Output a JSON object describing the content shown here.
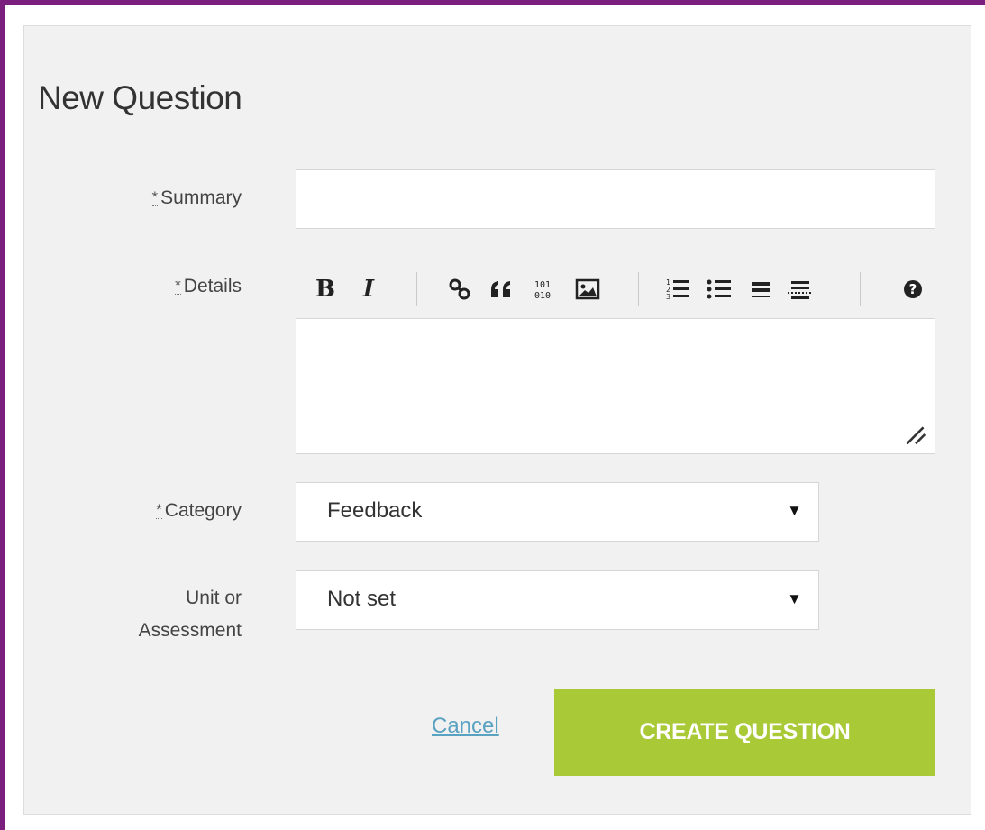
{
  "form": {
    "title": "New Question",
    "required_marker": "*",
    "summary": {
      "label": "Summary",
      "value": "",
      "placeholder": ""
    },
    "details": {
      "label": "Details",
      "value": "",
      "toolbar": {
        "bold_label": "B",
        "italic_label": "I",
        "link_icon": "link-icon",
        "quote_icon": "quote-icon",
        "code_icon": "code-sample-icon",
        "code_text": "101\n010",
        "image_icon": "image-icon",
        "ordered_list_icon": "ordered-list-icon",
        "bulleted_list_icon": "bulleted-list-icon",
        "heading_icon": "heading-icon",
        "hr_icon": "horizontal-rule-icon",
        "help_icon": "help-icon",
        "help_text": "?"
      }
    },
    "category": {
      "label": "Category",
      "selected": "Feedback"
    },
    "unit": {
      "label_line1": "Unit or",
      "label_line2": "Assessment",
      "selected": "Not set"
    },
    "select_arrow": "▼",
    "cancel_label": "Cancel",
    "create_label": "CREATE QUESTION"
  },
  "colors": {
    "frame_border": "#7b1f7f",
    "panel_bg": "#f1f1f1",
    "primary_button": "#a9c937",
    "link": "#5aa2c2"
  }
}
